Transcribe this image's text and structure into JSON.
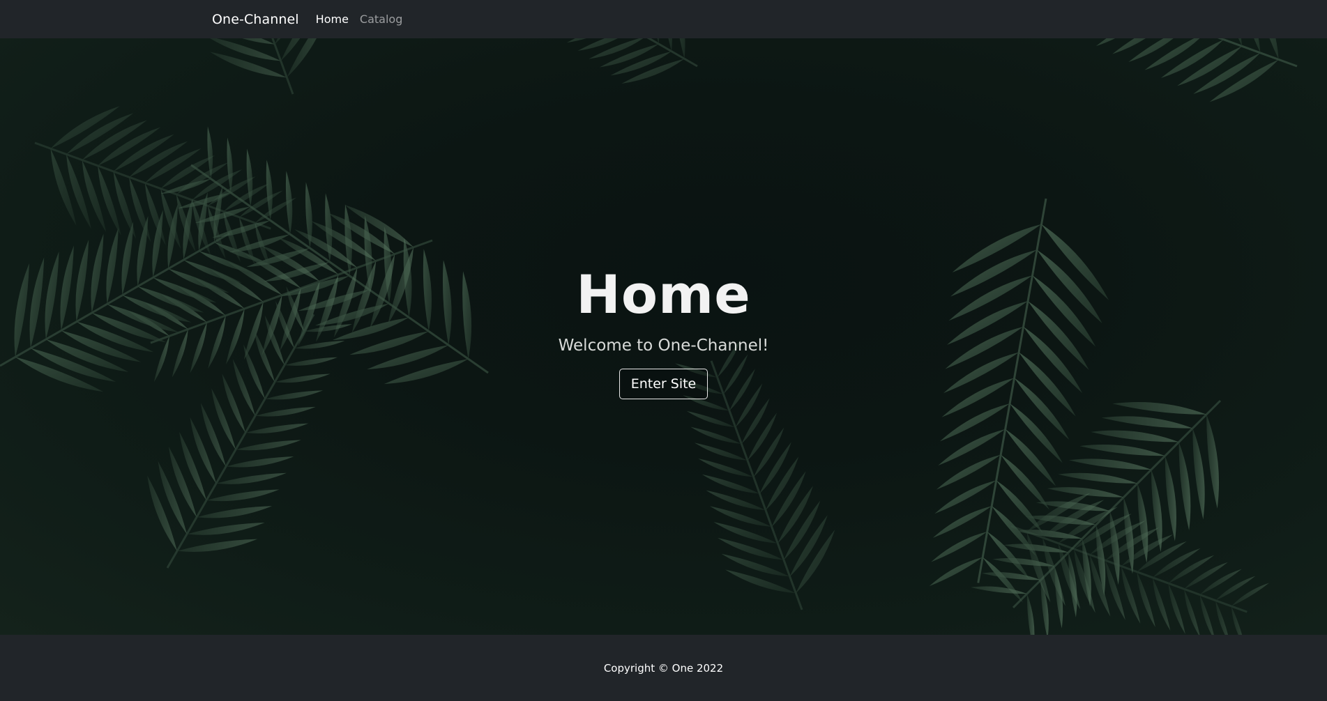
{
  "navbar": {
    "brand": "One-Channel",
    "links": [
      {
        "label": "Home",
        "active": true
      },
      {
        "label": "Catalog",
        "active": false
      }
    ]
  },
  "hero": {
    "title": "Home",
    "subtitle": "Welcome to One-Channel!",
    "button_label": "Enter Site",
    "background_image": "palm-leaves-photo"
  },
  "footer": {
    "copyright": "Copyright © One 2022"
  },
  "colors": {
    "navbar_bg": "#212529",
    "footer_bg": "#212529",
    "hero_text": "#f2f2f2",
    "leaf_green": "#3f5a48"
  }
}
